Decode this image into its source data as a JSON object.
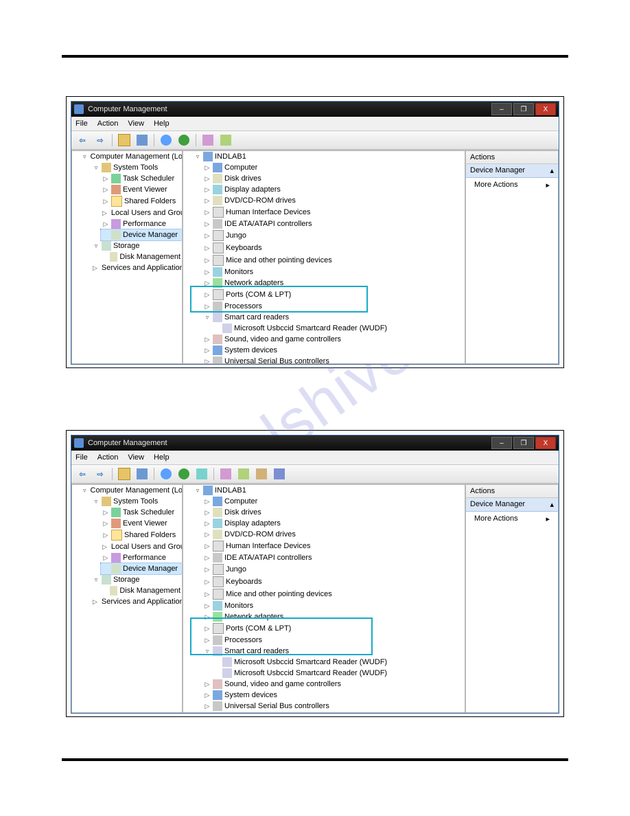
{
  "watermark": "manualshive.com",
  "window": {
    "title": "Computer Management",
    "menu": {
      "file": "File",
      "action": "Action",
      "view": "View",
      "help": "Help"
    },
    "caption": {
      "min": "–",
      "max": "❐",
      "close": "X"
    }
  },
  "actions": {
    "header": "Actions",
    "section": "Device Manager",
    "more": "More Actions",
    "collapse": "▴",
    "arrow": "▸"
  },
  "nav": {
    "root": "Computer Management (Local",
    "system_tools": "System Tools",
    "task_scheduler": "Task Scheduler",
    "event_viewer": "Event Viewer",
    "shared_folders": "Shared Folders",
    "local_users": "Local Users and Groups",
    "performance": "Performance",
    "device_manager": "Device Manager",
    "storage": "Storage",
    "disk_management": "Disk Management",
    "services_apps": "Services and Applications"
  },
  "devices": {
    "root": "INDLAB1",
    "computer": "Computer",
    "disk_drives": "Disk drives",
    "display_adapters": "Display adapters",
    "dvd": "DVD/CD-ROM drives",
    "hid": "Human Interface Devices",
    "ide": "IDE ATA/ATAPI controllers",
    "jungo": "Jungo",
    "keyboards": "Keyboards",
    "mice": "Mice and other pointing devices",
    "monitors": "Monitors",
    "network": "Network adapters",
    "ports": "Ports (COM & LPT)",
    "processors": "Processors",
    "smart_card": "Smart card readers",
    "smart_card_item": "Microsoft Usbccid Smartcard Reader (WUDF)",
    "sound": "Sound, video and game controllers",
    "system_devices": "System devices",
    "usb": "Universal Serial Bus controllers"
  },
  "glyph": {
    "closed": "▷",
    "open": "▿"
  }
}
